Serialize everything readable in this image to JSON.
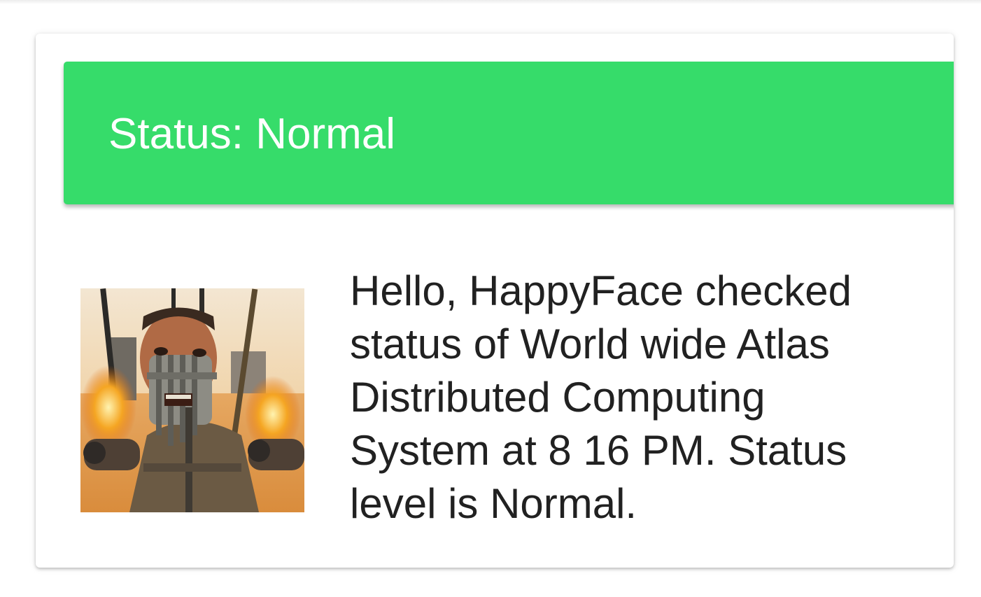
{
  "status": {
    "title": "Status: Normal",
    "level": "Normal",
    "color": "#36dc6a"
  },
  "notification": {
    "message": "Hello, HappyFace checked status of World wide Atlas Distributed Computing System at 8 16 PM. Status level is Normal."
  },
  "avatar": {
    "icon": "avatar-photo"
  }
}
